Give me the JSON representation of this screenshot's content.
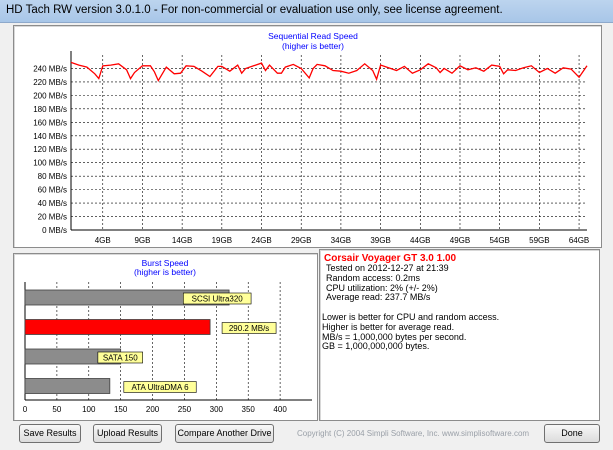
{
  "window": {
    "title": "HD Tach RW version 3.0.1.0  - For non-commercial or evaluation use only, see license agreement."
  },
  "colors": {
    "line_red": "#ff0000",
    "gridline": "#000000",
    "bar_gray": "#8c8c8c",
    "bar_highlight": "#ff0000",
    "label_bg": "#ffff99",
    "title_blue": "#0000ff"
  },
  "sequential": {
    "title": "Sequential Read Speed",
    "subtitle": "(higher is better)",
    "chart_data": {
      "type": "line",
      "title": "Sequential Read Speed",
      "subtitle": "(higher is better)",
      "y_tick_labels": [
        "0 MB/s",
        "20 MB/s",
        "40 MB/s",
        "60 MB/s",
        "80 MB/s",
        "100 MB/s",
        "120 MB/s",
        "140 MB/s",
        "160 MB/s",
        "180 MB/s",
        "200 MB/s",
        "220 MB/s",
        "240 MB/s"
      ],
      "x_tick_labels": [
        "4GB",
        "9GB",
        "14GB",
        "19GB",
        "24GB",
        "29GB",
        "34GB",
        "39GB",
        "44GB",
        "49GB",
        "54GB",
        "59GB",
        "64GB"
      ],
      "ylim": [
        0,
        260
      ],
      "xlim": [
        0,
        65
      ],
      "grid": true,
      "series": [
        {
          "x": [
            0,
            1,
            2,
            3,
            3.5,
            4,
            5,
            6,
            7,
            7.5,
            8,
            9,
            10,
            10.5,
            11,
            12,
            13,
            13.8,
            14.5,
            15.5,
            16.5,
            17.5,
            18.5,
            19,
            20,
            21,
            21.5,
            22,
            23,
            24,
            24.5,
            25,
            26,
            26.5,
            27,
            28,
            29,
            30,
            30.5,
            31,
            32,
            33,
            34,
            35,
            36,
            37,
            38,
            38.5,
            39,
            40,
            41,
            42,
            43,
            44,
            45,
            46,
            46.5,
            47,
            48,
            49,
            50,
            51,
            52,
            53,
            54,
            54.5,
            55,
            56,
            57,
            58,
            59,
            60,
            61,
            62,
            63,
            64,
            65
          ],
          "y": [
            249,
            245,
            242,
            232,
            225,
            244,
            245,
            247,
            238,
            225,
            234,
            244,
            244,
            235,
            222,
            242,
            232,
            233,
            244,
            243,
            236,
            228,
            243,
            243,
            236,
            245,
            233,
            240,
            244,
            248,
            237,
            245,
            233,
            233,
            242,
            246,
            240,
            226,
            240,
            246,
            244,
            237,
            236,
            233,
            237,
            247,
            237,
            224,
            245,
            241,
            237,
            243,
            233,
            238,
            247,
            241,
            234,
            240,
            233,
            244,
            238,
            241,
            236,
            245,
            243,
            232,
            238,
            237,
            241,
            244,
            234,
            240,
            233,
            241,
            239,
            227,
            244
          ]
        }
      ]
    }
  },
  "burst": {
    "title": "Burst Speed",
    "subtitle": "(higher is better)",
    "chart_data": {
      "type": "bar",
      "orientation": "horizontal",
      "title": "Burst Speed",
      "subtitle": "(higher is better)",
      "xlim": [
        0,
        450
      ],
      "x_tick_labels": [
        "0",
        "50",
        "100",
        "150",
        "200",
        "250",
        "300",
        "350",
        "400"
      ],
      "grid": true,
      "bars": [
        {
          "label": "SCSI Ultra320",
          "value": 320,
          "highlight": false
        },
        {
          "label": "290.2 MB/s",
          "value": 290.2,
          "highlight": true
        },
        {
          "label": "SATA 150",
          "value": 150,
          "highlight": false
        },
        {
          "label": "ATA UltraDMA 6",
          "value": 133,
          "highlight": false
        }
      ]
    }
  },
  "info": {
    "drive_name": "Corsair Voyager GT 3.0 1.00",
    "lines": [
      "Tested on 2012-12-27 at 21:39",
      "Random access: 0.2ms",
      "CPU utilization: 2% (+/- 2%)",
      "Average read: 237.7 MB/s"
    ],
    "notes": [
      "Lower is better for CPU and random access.",
      "Higher is better for average read.",
      "MB/s = 1,000,000 bytes per second.",
      "GB = 1,000,000,000 bytes."
    ]
  },
  "buttons": {
    "save": "Save Results",
    "upload": "Upload Results",
    "compare": "Compare Another Drive",
    "done": "Done"
  },
  "copyright": "Copyright (C) 2004 Simpli Software, Inc. www.simplisoftware.com"
}
